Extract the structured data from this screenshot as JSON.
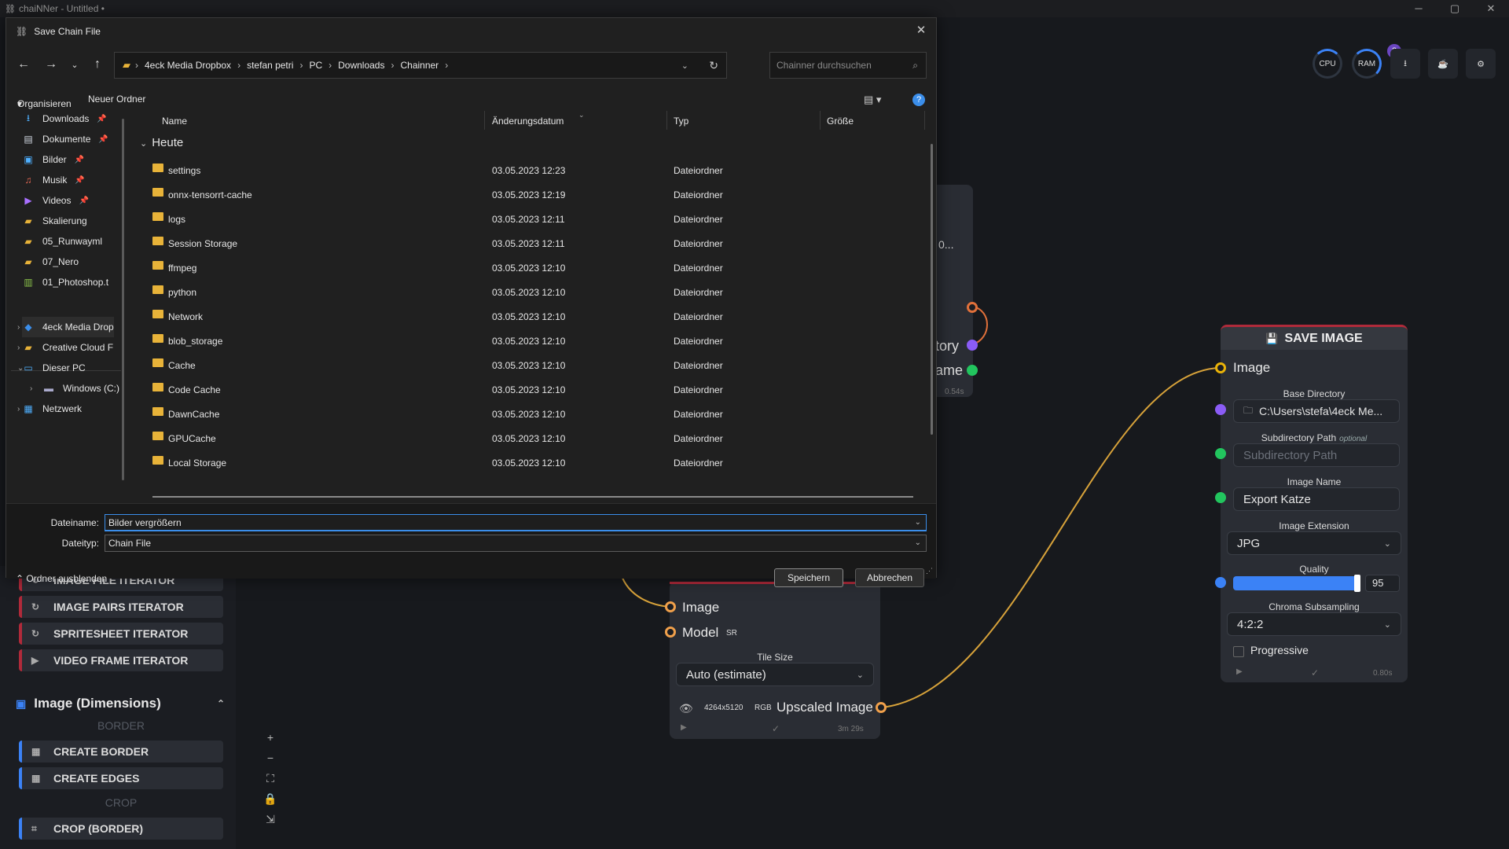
{
  "window": {
    "title": "chaiNNer - Untitled •",
    "controls": [
      "─",
      "▢",
      "✕"
    ]
  },
  "header": {
    "cpu_label": "CPU",
    "ram_label": "RAM",
    "badge_count": "2",
    "icons": [
      "download-icon",
      "kofi-icon",
      "settings-icon"
    ]
  },
  "node_list": {
    "items_top": [
      {
        "label": "IMAGE FILE ITERATOR"
      },
      {
        "label": "IMAGE PAIRS ITERATOR"
      },
      {
        "label": "SPRITESHEET ITERATOR"
      },
      {
        "label": "VIDEO FRAME ITERATOR"
      }
    ],
    "category": "Image (Dimensions)",
    "border_label": "BORDER",
    "crop_label": "CROP",
    "border_items": [
      {
        "label": "CREATE BORDER"
      },
      {
        "label": "CREATE EDGES"
      }
    ],
    "crop_items": [
      {
        "label": "CROP (BORDER)"
      }
    ]
  },
  "partial_node": {
    "text1": "0...",
    "text2": "tory",
    "text3": "ame",
    "footer": "0.54s"
  },
  "upscale_node": {
    "input_image": "Image",
    "input_model": "Model",
    "model_tag": "SR",
    "tile_label": "Tile Size",
    "tile_value": "Auto (estimate)",
    "output_size": "4264x5120",
    "output_mode": "RGB",
    "output_label": "Upscaled Image",
    "footer_time": "3m 29s"
  },
  "save_node": {
    "title": "SAVE IMAGE",
    "input_image": "Image",
    "base_dir_label": "Base Directory",
    "base_dir_value": "C:\\Users\\stefa\\4eck Me...",
    "subdir_label": "Subdirectory Path",
    "subdir_optional": "optional",
    "subdir_placeholder": "Subdirectory Path",
    "name_label": "Image Name",
    "name_value": "Export Katze",
    "ext_label": "Image Extension",
    "ext_value": "JPG",
    "quality_label": "Quality",
    "quality_value": "95",
    "quality_fraction": 0.95,
    "chroma_label": "Chroma Subsampling",
    "chroma_value": "4:2:2",
    "progressive_label": "Progressive",
    "footer_time": "0.80s"
  },
  "dialog": {
    "title": "Save Chain File",
    "breadcrumbs": [
      "4eck Media Dropbox",
      "stefan petri",
      "PC",
      "Downloads",
      "Chainner"
    ],
    "search_placeholder": "Chainner durchsuchen",
    "organize": "Organisieren",
    "new_folder": "Neuer Ordner",
    "nav_items": [
      {
        "label": "Downloads",
        "icon": "download-icon"
      },
      {
        "label": "Dokumente",
        "icon": "document-icon"
      },
      {
        "label": "Bilder",
        "icon": "image-icon"
      },
      {
        "label": "Musik",
        "icon": "music-icon"
      },
      {
        "label": "Videos",
        "icon": "video-icon"
      },
      {
        "label": "Skalierung",
        "icon": "folder-icon"
      },
      {
        "label": "05_Runwayml",
        "icon": "folder-icon"
      },
      {
        "label": "07_Nero",
        "icon": "folder-icon"
      },
      {
        "label": "01_Photoshop.t",
        "icon": "file-icon"
      }
    ],
    "nav_tree": [
      {
        "label": "4eck Media Drop",
        "icon": "dropbox-icon"
      },
      {
        "label": "Creative Cloud F",
        "icon": "creative-cloud-icon"
      },
      {
        "label": "Dieser PC",
        "icon": "pc-icon"
      },
      {
        "label": "Windows (C:)",
        "icon": "drive-icon"
      },
      {
        "label": "Netzwerk",
        "icon": "network-icon"
      }
    ],
    "columns": [
      "Name",
      "Änderungsdatum",
      "Typ",
      "Größe"
    ],
    "group": "Heute",
    "files": [
      {
        "name": "settings",
        "date": "03.05.2023 12:23",
        "type": "Dateiordner"
      },
      {
        "name": "onnx-tensorrt-cache",
        "date": "03.05.2023 12:19",
        "type": "Dateiordner"
      },
      {
        "name": "logs",
        "date": "03.05.2023 12:11",
        "type": "Dateiordner"
      },
      {
        "name": "Session Storage",
        "date": "03.05.2023 12:11",
        "type": "Dateiordner"
      },
      {
        "name": "ffmpeg",
        "date": "03.05.2023 12:10",
        "type": "Dateiordner"
      },
      {
        "name": "python",
        "date": "03.05.2023 12:10",
        "type": "Dateiordner"
      },
      {
        "name": "Network",
        "date": "03.05.2023 12:10",
        "type": "Dateiordner"
      },
      {
        "name": "blob_storage",
        "date": "03.05.2023 12:10",
        "type": "Dateiordner"
      },
      {
        "name": "Cache",
        "date": "03.05.2023 12:10",
        "type": "Dateiordner"
      },
      {
        "name": "Code Cache",
        "date": "03.05.2023 12:10",
        "type": "Dateiordner"
      },
      {
        "name": "DawnCache",
        "date": "03.05.2023 12:10",
        "type": "Dateiordner"
      },
      {
        "name": "GPUCache",
        "date": "03.05.2023 12:10",
        "type": "Dateiordner"
      },
      {
        "name": "Local Storage",
        "date": "03.05.2023 12:10",
        "type": "Dateiordner"
      }
    ],
    "filename_label": "Dateiname:",
    "filename_value": "Bilder vergrößern",
    "filetype_label": "Dateityp:",
    "filetype_value": "Chain File",
    "hide_folders": "Ordner ausblenden",
    "save_button": "Speichern",
    "cancel_button": "Abbrechen"
  }
}
